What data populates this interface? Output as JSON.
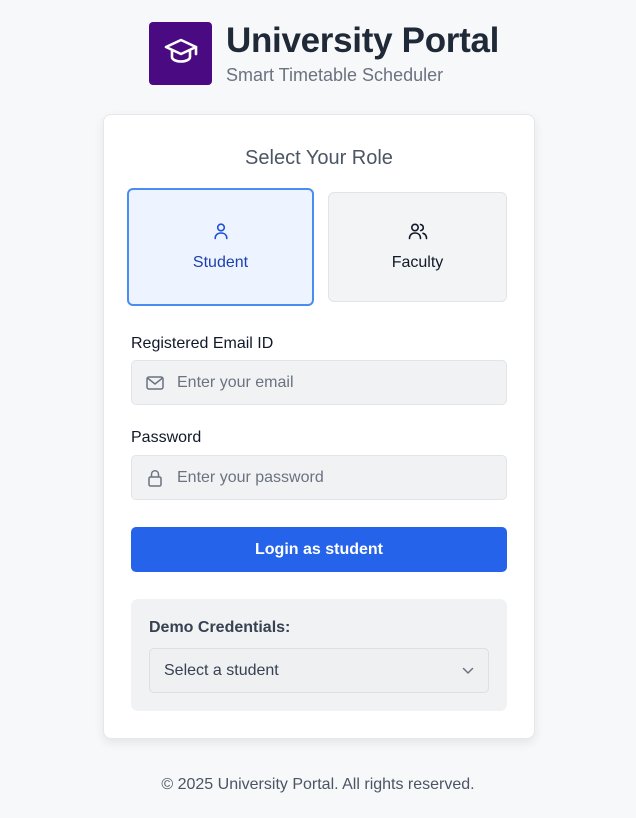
{
  "brand": {
    "title": "University Portal",
    "subtitle": "Smart Timetable Scheduler",
    "logo_icon": "graduation-cap-icon",
    "logo_color": "#4a0a82"
  },
  "login": {
    "heading": "Select Your Role",
    "roles": [
      {
        "label": "Student",
        "icon": "user-icon",
        "selected": true
      },
      {
        "label": "Faculty",
        "icon": "users-icon",
        "selected": false
      }
    ],
    "email": {
      "label": "Registered Email ID",
      "placeholder": "Enter your email",
      "value": "",
      "icon": "mail-icon"
    },
    "password": {
      "label": "Password",
      "placeholder": "Enter your password",
      "value": "",
      "icon": "lock-icon"
    },
    "submit_label": "Login as student",
    "accent_color": "#2563eb"
  },
  "demo": {
    "title": "Demo Credentials:",
    "select_value": "Select a student",
    "select_icon": "chevron-down-icon"
  },
  "footer": {
    "text": "© 2025 University Portal. All rights reserved."
  }
}
